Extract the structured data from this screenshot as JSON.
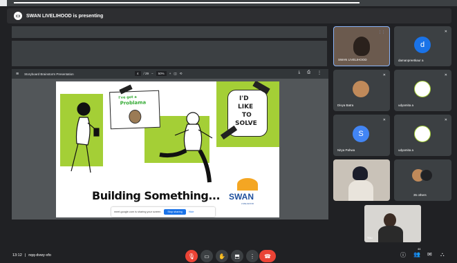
{
  "presenter_bar": {
    "text": "SWAN LIVELIHOOD is presenting"
  },
  "pdf_viewer": {
    "file_name": "Storyboard Brainstorm Presentation",
    "page": "4",
    "page_total": "/ 29",
    "zoom": "50%"
  },
  "slide": {
    "sticker_line1": "I've got a",
    "sticker_line2": "Problama",
    "note_line1": "I'D",
    "note_line2": "LIKE",
    "note_line3": "TO",
    "note_line4": "SOLVE",
    "headline": "Building Something...",
    "brand": "SWAN",
    "brand_sub": "LIVELIHOOD",
    "accent_color": "#a4cf36"
  },
  "share_toast": {
    "message": "meet.google.com is sharing your screen.",
    "stop_label": "Stop sharing",
    "hide_label": "Hide"
  },
  "participants": [
    {
      "name": "SWAN LIVELIHOOD"
    },
    {
      "name": "damanpreetkaur a",
      "initial": "d",
      "color": "#1a73e8"
    },
    {
      "name": "Divya Batra"
    },
    {
      "name": "udyamita a"
    },
    {
      "name": "Nitya Pahwa",
      "initial": "S",
      "color": "#4285f4"
    },
    {
      "name": "udyamita a"
    },
    {
      "name": ""
    },
    {
      "name": "35 others"
    }
  ],
  "self_view": {
    "label": "You"
  },
  "meeting": {
    "time": "13:12",
    "separator": "|",
    "code": "nqq-dvwy-xfo"
  },
  "controls": {
    "mic_icon": "mic-off-icon",
    "camera_icon": "camera-icon",
    "hand_icon": "raise-hand-icon",
    "present_icon": "present-icon",
    "more_icon": "more-icon",
    "end_icon": "end-call-icon",
    "participants_count": "44"
  }
}
